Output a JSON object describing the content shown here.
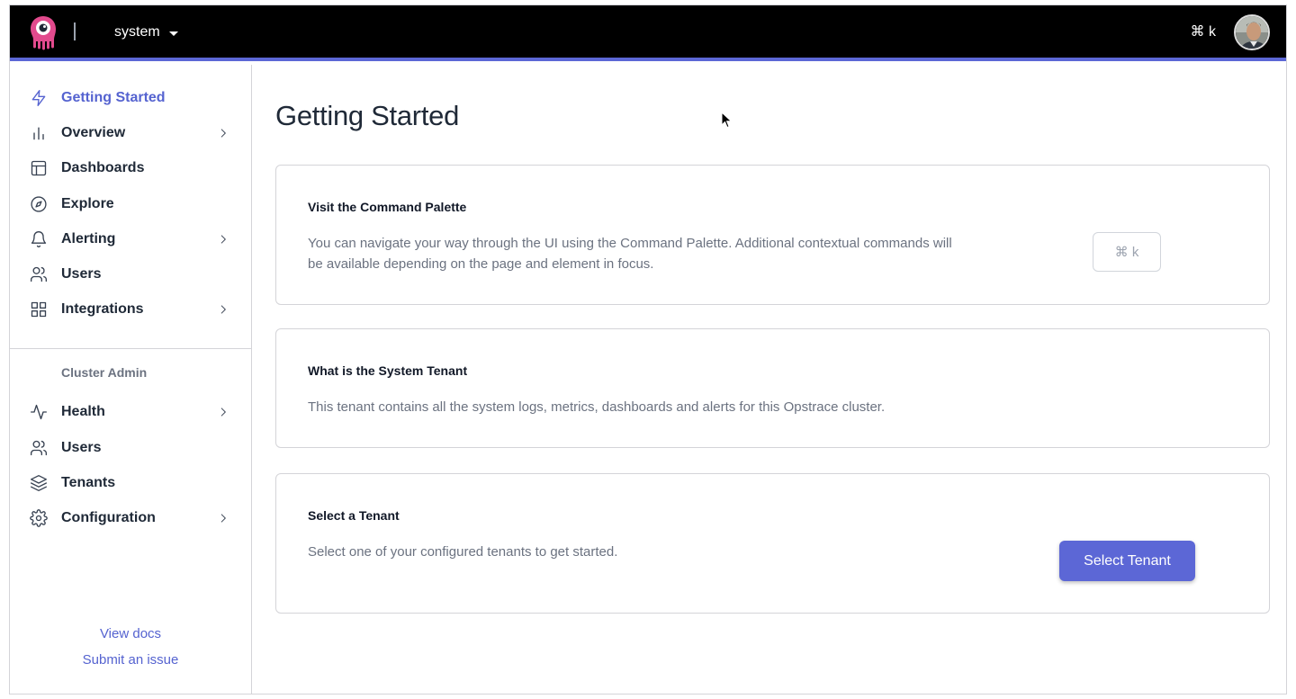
{
  "topbar": {
    "tenant_label": "system",
    "command_shortcut": "⌘ k"
  },
  "sidebar": {
    "items": [
      {
        "label": "Getting Started",
        "icon": "lightning-icon",
        "active": true
      },
      {
        "label": "Overview",
        "icon": "bar-chart-icon",
        "has_children": true
      },
      {
        "label": "Dashboards",
        "icon": "layout-icon"
      },
      {
        "label": "Explore",
        "icon": "compass-icon"
      },
      {
        "label": "Alerting",
        "icon": "bell-icon",
        "has_children": true
      },
      {
        "label": "Users",
        "icon": "users-icon"
      },
      {
        "label": "Integrations",
        "icon": "grid-icon",
        "has_children": true
      }
    ],
    "admin_section_title": "Cluster Admin",
    "admin_items": [
      {
        "label": "Health",
        "icon": "activity-icon",
        "has_children": true
      },
      {
        "label": "Users",
        "icon": "users-icon"
      },
      {
        "label": "Tenants",
        "icon": "layers-icon"
      },
      {
        "label": "Configuration",
        "icon": "gear-icon",
        "has_children": true
      }
    ],
    "footer_links": {
      "docs": "View docs",
      "issue": "Submit an issue"
    }
  },
  "main": {
    "title": "Getting Started",
    "cards": [
      {
        "title": "Visit the Command Palette",
        "body_line1": "You can navigate your way through the UI using the Command Palette. Additional contextual commands will",
        "body_line2": "be available depending on the page and element in focus.",
        "button_label": "⌘ k"
      },
      {
        "title": "What is the System Tenant",
        "body": "This tenant contains all the system logs, metrics, dashboards and alerts for this Opstrace cluster."
      },
      {
        "title": "Select a Tenant",
        "body": "Select one of your configured tenants to get started.",
        "button_label": "Select Tenant"
      }
    ]
  },
  "colors": {
    "accent": "#5c67d6",
    "topbar": "#000000",
    "logo": "#e24a8d"
  }
}
